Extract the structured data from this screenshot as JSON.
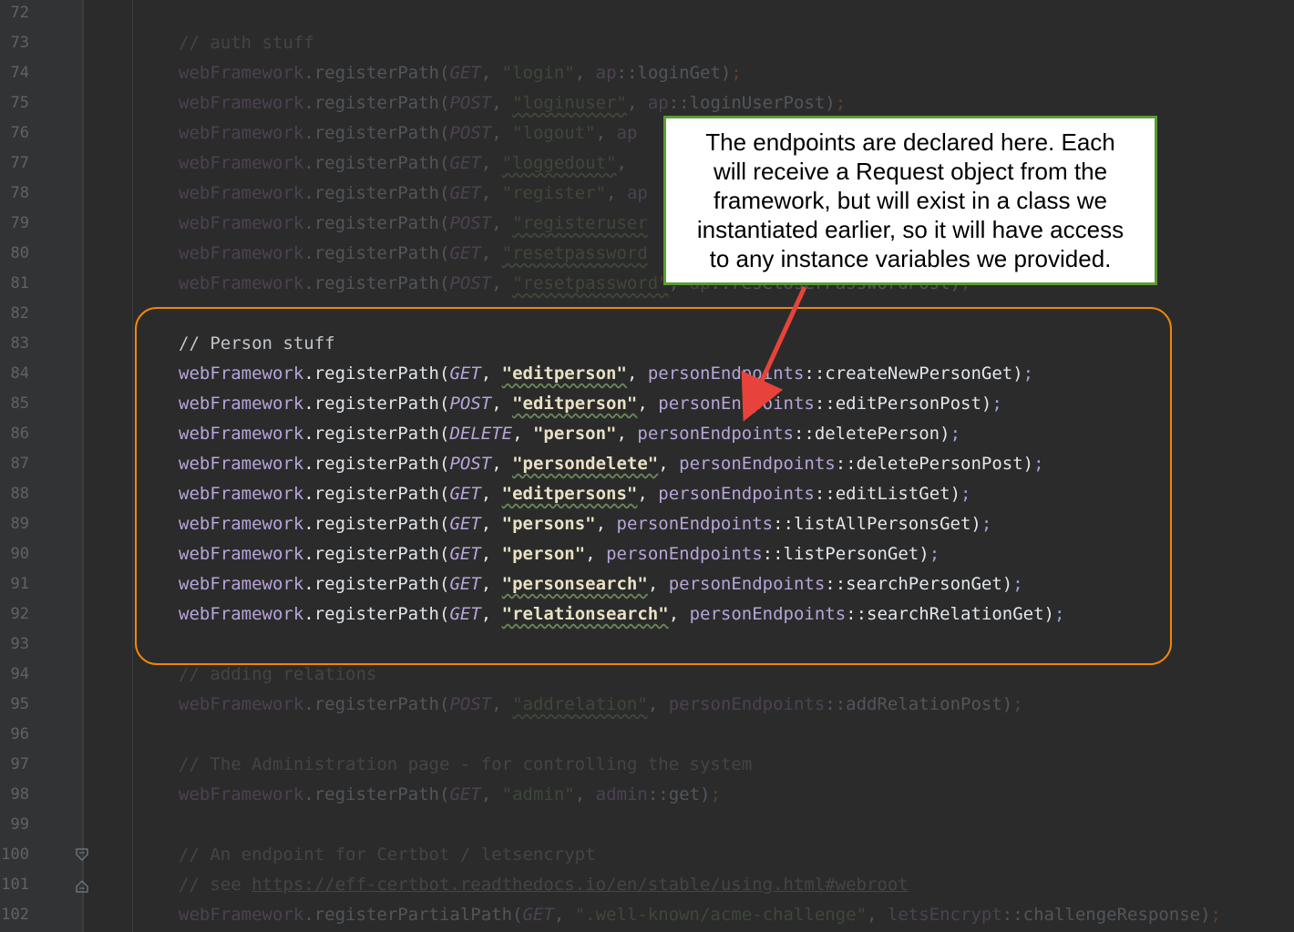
{
  "line_numbers": [
    "72",
    "73",
    "74",
    "75",
    "76",
    "77",
    "78",
    "79",
    "80",
    "81",
    "82",
    "83",
    "84",
    "85",
    "86",
    "87",
    "88",
    "89",
    "90",
    "91",
    "92",
    "93",
    "94",
    "95",
    "96",
    "97",
    "98",
    "99",
    "100",
    "101",
    "102"
  ],
  "code_lines": [
    {
      "hi": false,
      "tokens": []
    },
    {
      "hi": false,
      "tokens": [
        {
          "t": "// auth stuff",
          "c": "com"
        }
      ]
    },
    {
      "hi": false,
      "tokens": [
        {
          "t": "webFramework",
          "c": "obj"
        },
        {
          "t": ".registerPath(",
          "c": "plain"
        },
        {
          "t": "GET",
          "c": "enum"
        },
        {
          "t": ", ",
          "c": "plain"
        },
        {
          "t": "\"login\"",
          "c": "str"
        },
        {
          "t": ", ",
          "c": "plain"
        },
        {
          "t": "ap",
          "c": "obj"
        },
        {
          "t": "::loginGet)",
          "c": "plain"
        },
        {
          "t": ";",
          "c": "semi"
        }
      ]
    },
    {
      "hi": false,
      "tokens": [
        {
          "t": "webFramework",
          "c": "obj"
        },
        {
          "t": ".registerPath(",
          "c": "plain"
        },
        {
          "t": "POST",
          "c": "enum"
        },
        {
          "t": ", ",
          "c": "plain"
        },
        {
          "t": "\"loginuser\"",
          "c": "strw"
        },
        {
          "t": ", ",
          "c": "plain"
        },
        {
          "t": "ap",
          "c": "obj"
        },
        {
          "t": "::loginUserPost)",
          "c": "plain"
        },
        {
          "t": ";",
          "c": "semi"
        }
      ]
    },
    {
      "hi": false,
      "tokens": [
        {
          "t": "webFramework",
          "c": "obj"
        },
        {
          "t": ".registerPath(",
          "c": "plain"
        },
        {
          "t": "POST",
          "c": "enum"
        },
        {
          "t": ", ",
          "c": "plain"
        },
        {
          "t": "\"logout\"",
          "c": "str"
        },
        {
          "t": ", ",
          "c": "plain"
        },
        {
          "t": "ap",
          "c": "obj"
        }
      ]
    },
    {
      "hi": false,
      "tokens": [
        {
          "t": "webFramework",
          "c": "obj"
        },
        {
          "t": ".registerPath(",
          "c": "plain"
        },
        {
          "t": "GET",
          "c": "enum"
        },
        {
          "t": ", ",
          "c": "plain"
        },
        {
          "t": "\"loggedout\"",
          "c": "strw"
        },
        {
          "t": ", ",
          "c": "plain"
        }
      ]
    },
    {
      "hi": false,
      "tokens": [
        {
          "t": "webFramework",
          "c": "obj"
        },
        {
          "t": ".registerPath(",
          "c": "plain"
        },
        {
          "t": "GET",
          "c": "enum"
        },
        {
          "t": ", ",
          "c": "plain"
        },
        {
          "t": "\"register\"",
          "c": "str"
        },
        {
          "t": ", ",
          "c": "plain"
        },
        {
          "t": "ap",
          "c": "obj"
        }
      ]
    },
    {
      "hi": false,
      "tokens": [
        {
          "t": "webFramework",
          "c": "obj"
        },
        {
          "t": ".registerPath(",
          "c": "plain"
        },
        {
          "t": "POST",
          "c": "enum"
        },
        {
          "t": ", ",
          "c": "plain"
        },
        {
          "t": "\"registeruser",
          "c": "strw"
        }
      ]
    },
    {
      "hi": false,
      "tokens": [
        {
          "t": "webFramework",
          "c": "obj"
        },
        {
          "t": ".registerPath(",
          "c": "plain"
        },
        {
          "t": "GET",
          "c": "enum"
        },
        {
          "t": ", ",
          "c": "plain"
        },
        {
          "t": "\"resetpassword",
          "c": "strw"
        }
      ]
    },
    {
      "hi": false,
      "tokens": [
        {
          "t": "webFramework",
          "c": "obj"
        },
        {
          "t": ".registerPath(",
          "c": "plain"
        },
        {
          "t": "POST",
          "c": "enum"
        },
        {
          "t": ", ",
          "c": "plain"
        },
        {
          "t": "\"resetpassword\"",
          "c": "strw"
        },
        {
          "t": ", ",
          "c": "plain"
        },
        {
          "t": "ap",
          "c": "obj"
        },
        {
          "t": "::resetUserPasswordPost)",
          "c": "plain"
        },
        {
          "t": ";",
          "c": "semi"
        }
      ]
    },
    {
      "hi": false,
      "tokens": []
    },
    {
      "hi": true,
      "tokens": [
        {
          "t": "// Person stuff",
          "c": "com"
        }
      ]
    },
    {
      "hi": true,
      "tokens": [
        {
          "t": "webFramework",
          "c": "obj"
        },
        {
          "t": ".registerPath(",
          "c": "plain"
        },
        {
          "t": "GET",
          "c": "enum"
        },
        {
          "t": ", ",
          "c": "plain"
        },
        {
          "t": "\"editperson\"",
          "c": "strw"
        },
        {
          "t": ", ",
          "c": "plain"
        },
        {
          "t": "personEndpoints",
          "c": "obj"
        },
        {
          "t": "::createNewPersonGet)",
          "c": "plain"
        },
        {
          "t": ";",
          "c": "semi"
        }
      ]
    },
    {
      "hi": true,
      "tokens": [
        {
          "t": "webFramework",
          "c": "obj"
        },
        {
          "t": ".registerPath(",
          "c": "plain"
        },
        {
          "t": "POST",
          "c": "enum"
        },
        {
          "t": ", ",
          "c": "plain"
        },
        {
          "t": "\"editperson\"",
          "c": "strw"
        },
        {
          "t": ", ",
          "c": "plain"
        },
        {
          "t": "personEndpoints",
          "c": "obj"
        },
        {
          "t": "::editPersonPost)",
          "c": "plain"
        },
        {
          "t": ";",
          "c": "semi"
        }
      ]
    },
    {
      "hi": true,
      "tokens": [
        {
          "t": "webFramework",
          "c": "obj"
        },
        {
          "t": ".registerPath(",
          "c": "plain"
        },
        {
          "t": "DELETE",
          "c": "enum"
        },
        {
          "t": ", ",
          "c": "plain"
        },
        {
          "t": "\"person\"",
          "c": "str"
        },
        {
          "t": ", ",
          "c": "plain"
        },
        {
          "t": "personEndpoints",
          "c": "obj"
        },
        {
          "t": "::deletePerson)",
          "c": "plain"
        },
        {
          "t": ";",
          "c": "semi"
        }
      ]
    },
    {
      "hi": true,
      "tokens": [
        {
          "t": "webFramework",
          "c": "obj"
        },
        {
          "t": ".registerPath(",
          "c": "plain"
        },
        {
          "t": "POST",
          "c": "enum"
        },
        {
          "t": ", ",
          "c": "plain"
        },
        {
          "t": "\"persondelete\"",
          "c": "strw"
        },
        {
          "t": ", ",
          "c": "plain"
        },
        {
          "t": "personEndpoints",
          "c": "obj"
        },
        {
          "t": "::deletePersonPost)",
          "c": "plain"
        },
        {
          "t": ";",
          "c": "semi"
        }
      ]
    },
    {
      "hi": true,
      "tokens": [
        {
          "t": "webFramework",
          "c": "obj"
        },
        {
          "t": ".registerPath(",
          "c": "plain"
        },
        {
          "t": "GET",
          "c": "enum"
        },
        {
          "t": ", ",
          "c": "plain"
        },
        {
          "t": "\"editpersons\"",
          "c": "strw"
        },
        {
          "t": ", ",
          "c": "plain"
        },
        {
          "t": "personEndpoints",
          "c": "obj"
        },
        {
          "t": "::editListGet)",
          "c": "plain"
        },
        {
          "t": ";",
          "c": "semi"
        }
      ]
    },
    {
      "hi": true,
      "tokens": [
        {
          "t": "webFramework",
          "c": "obj"
        },
        {
          "t": ".registerPath(",
          "c": "plain"
        },
        {
          "t": "GET",
          "c": "enum"
        },
        {
          "t": ", ",
          "c": "plain"
        },
        {
          "t": "\"persons\"",
          "c": "str"
        },
        {
          "t": ", ",
          "c": "plain"
        },
        {
          "t": "personEndpoints",
          "c": "obj"
        },
        {
          "t": "::listAllPersonsGet)",
          "c": "plain"
        },
        {
          "t": ";",
          "c": "semi"
        }
      ]
    },
    {
      "hi": true,
      "tokens": [
        {
          "t": "webFramework",
          "c": "obj"
        },
        {
          "t": ".registerPath(",
          "c": "plain"
        },
        {
          "t": "GET",
          "c": "enum"
        },
        {
          "t": ", ",
          "c": "plain"
        },
        {
          "t": "\"person\"",
          "c": "str"
        },
        {
          "t": ", ",
          "c": "plain"
        },
        {
          "t": "personEndpoints",
          "c": "obj"
        },
        {
          "t": "::listPersonGet)",
          "c": "plain"
        },
        {
          "t": ";",
          "c": "semi"
        }
      ]
    },
    {
      "hi": true,
      "tokens": [
        {
          "t": "webFramework",
          "c": "obj"
        },
        {
          "t": ".registerPath(",
          "c": "plain"
        },
        {
          "t": "GET",
          "c": "enum"
        },
        {
          "t": ", ",
          "c": "plain"
        },
        {
          "t": "\"personsearch\"",
          "c": "strw"
        },
        {
          "t": ", ",
          "c": "plain"
        },
        {
          "t": "personEndpoints",
          "c": "obj"
        },
        {
          "t": "::searchPersonGet)",
          "c": "plain"
        },
        {
          "t": ";",
          "c": "semi"
        }
      ]
    },
    {
      "hi": true,
      "tokens": [
        {
          "t": "webFramework",
          "c": "obj"
        },
        {
          "t": ".registerPath(",
          "c": "plain"
        },
        {
          "t": "GET",
          "c": "enum"
        },
        {
          "t": ", ",
          "c": "plain"
        },
        {
          "t": "\"relationsearch\"",
          "c": "strw"
        },
        {
          "t": ", ",
          "c": "plain"
        },
        {
          "t": "personEndpoints",
          "c": "obj"
        },
        {
          "t": "::searchRelationGet)",
          "c": "plain"
        },
        {
          "t": ";",
          "c": "semi"
        }
      ]
    },
    {
      "hi": false,
      "tokens": []
    },
    {
      "hi": false,
      "tokens": [
        {
          "t": "// adding relations",
          "c": "com"
        }
      ]
    },
    {
      "hi": false,
      "tokens": [
        {
          "t": "webFramework",
          "c": "obj"
        },
        {
          "t": ".registerPath(",
          "c": "plain"
        },
        {
          "t": "POST",
          "c": "enum"
        },
        {
          "t": ", ",
          "c": "plain"
        },
        {
          "t": "\"addrelation\"",
          "c": "strw"
        },
        {
          "t": ", ",
          "c": "plain"
        },
        {
          "t": "personEndpoints",
          "c": "obj"
        },
        {
          "t": "::addRelationPost)",
          "c": "plain"
        },
        {
          "t": ";",
          "c": "semi"
        }
      ]
    },
    {
      "hi": false,
      "tokens": []
    },
    {
      "hi": false,
      "tokens": [
        {
          "t": "// The Administration page - for controlling the system",
          "c": "com"
        }
      ]
    },
    {
      "hi": false,
      "tokens": [
        {
          "t": "webFramework",
          "c": "obj"
        },
        {
          "t": ".registerPath(",
          "c": "plain"
        },
        {
          "t": "GET",
          "c": "enum"
        },
        {
          "t": ", ",
          "c": "plain"
        },
        {
          "t": "\"admin\"",
          "c": "str"
        },
        {
          "t": ", ",
          "c": "plain"
        },
        {
          "t": "admin",
          "c": "obj"
        },
        {
          "t": "::get)",
          "c": "plain"
        },
        {
          "t": ";",
          "c": "semi"
        }
      ]
    },
    {
      "hi": false,
      "tokens": []
    },
    {
      "hi": false,
      "tokens": [
        {
          "t": "// An endpoint for Certbot / ",
          "c": "com"
        },
        {
          "t": "letsencrypt",
          "c": "com"
        }
      ]
    },
    {
      "hi": false,
      "tokens": [
        {
          "t": "// see ",
          "c": "com"
        },
        {
          "t": "https://eff-certbot.readthedocs.io/en/stable/using.html#webroot",
          "c": "link"
        }
      ]
    },
    {
      "hi": false,
      "tokens": [
        {
          "t": "webFramework",
          "c": "obj"
        },
        {
          "t": ".registerPartialPath(",
          "c": "plain"
        },
        {
          "t": "GET",
          "c": "enum"
        },
        {
          "t": ", ",
          "c": "plain"
        },
        {
          "t": "\".well-known/acme-challenge\"",
          "c": "str"
        },
        {
          "t": ", ",
          "c": "plain"
        },
        {
          "t": "letsEncrypt",
          "c": "obj"
        },
        {
          "t": "::challengeResponse)",
          "c": "plain"
        },
        {
          "t": ";",
          "c": "semi"
        }
      ]
    }
  ],
  "callout": {
    "lines": [
      "The endpoints are declared here.  Each",
      "will receive a Request object from the",
      "framework, but will exist in a class we",
      "instantiated earlier, so it will have access",
      "to any instance variables we provided."
    ]
  },
  "colors": {
    "background": "#2b2b2b",
    "gutter": "#313335",
    "highlight_border": "#f0860a",
    "callout_border": "#5b9c33",
    "arrow": "#e8433a"
  }
}
